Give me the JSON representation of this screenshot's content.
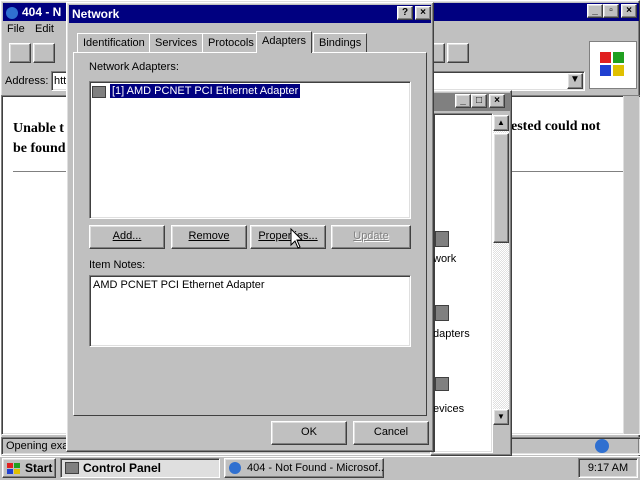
{
  "browser": {
    "title": "404 - N",
    "menu": {
      "file": "File",
      "edit": "Edit"
    },
    "address_label": "Address:",
    "address_value": "htt",
    "page_text_left_1": "Unable t",
    "page_text_left_2": "be found",
    "page_text_right": "ested could not",
    "status": "Opening exa"
  },
  "control_panel": {
    "items": [
      "work",
      "dapters",
      "evices"
    ]
  },
  "dialog": {
    "title": "Network",
    "help_btn": "?",
    "close_btn": "×",
    "tabs": [
      "Identification",
      "Services",
      "Protocols",
      "Adapters",
      "Bindings"
    ],
    "active_tab": "Adapters",
    "adapters_label": "Network Adapters:",
    "adapters": [
      "[1] AMD PCNET PCI Ethernet Adapter"
    ],
    "buttons": {
      "add": "Add...",
      "remove": "Remove",
      "properties": "Properties...",
      "update": "Update"
    },
    "notes_label": "Item Notes:",
    "notes_text": "AMD PCNET PCI Ethernet Adapter",
    "ok": "OK",
    "cancel": "Cancel"
  },
  "taskbar": {
    "start": "Start",
    "tasks": [
      "Control Panel",
      "404 - Not Found - Microsof..."
    ],
    "clock": "9:17 AM"
  },
  "colors": {
    "titlebar": "#000080",
    "desktop": "#c0c0c0",
    "selection": "#000080"
  }
}
